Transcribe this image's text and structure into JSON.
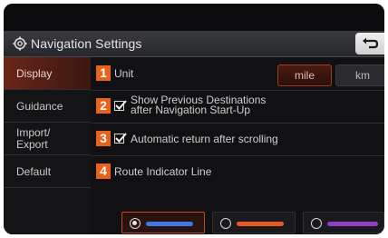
{
  "title": "Navigation Settings",
  "sidebar": {
    "items": [
      {
        "label": "Display",
        "active": true
      },
      {
        "label": "Guidance",
        "active": false
      },
      {
        "label": "Import/\nExport",
        "active": false
      },
      {
        "label": "Default",
        "active": false
      }
    ]
  },
  "settings": [
    {
      "num": "1",
      "label": "Unit"
    },
    {
      "num": "2",
      "label": "Show Previous Destinations after Navigation Start-Up",
      "line1": "Show Previous Destinations",
      "line2": "after Navigation Start-Up",
      "checked": true
    },
    {
      "num": "3",
      "label": "Automatic return after scrolling",
      "checked": true
    },
    {
      "num": "4",
      "label": "Route Indicator Line"
    }
  ],
  "unit_options": {
    "mile": "mile",
    "km": "km",
    "selected": "mile"
  },
  "route_colors": [
    {
      "color": "#3f78e6",
      "selected": true
    },
    {
      "color": "#e85a25",
      "selected": false
    },
    {
      "color": "#8f3fc4",
      "selected": false
    }
  ],
  "colors": {
    "accent": "#e8621c",
    "active": "#6a2618"
  }
}
